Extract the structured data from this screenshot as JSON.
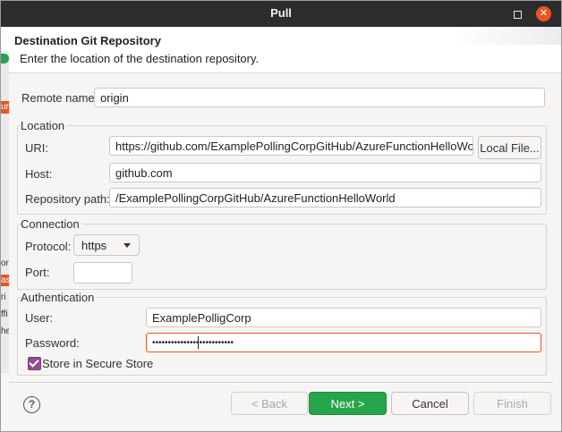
{
  "window": {
    "title": "Pull",
    "minimize_icon": "minimize-icon",
    "close_icon": "close-icon",
    "close_glyph": "✕"
  },
  "banner": {
    "title": "Destination Git Repository",
    "description": "Enter the location of the destination repository."
  },
  "side": {
    "marks": [
      "ur",
      "or",
      "as",
      "ri",
      "ffi",
      "he"
    ]
  },
  "remote": {
    "label": "Remote name:",
    "value": "origin"
  },
  "location": {
    "group_label": "Location",
    "uri_label": "URI:",
    "uri_value": "https://github.com/ExamplePollingCorpGitHub/AzureFunctionHelloWorld",
    "local_file_button": "Local File...",
    "host_label": "Host:",
    "host_value": "github.com",
    "path_label": "Repository path:",
    "path_value": "/ExamplePollingCorpGitHub/AzureFunctionHelloWorld"
  },
  "connection": {
    "group_label": "Connection",
    "protocol_label": "Protocol:",
    "protocol_value": "https",
    "port_label": "Port:",
    "port_value": ""
  },
  "authentication": {
    "group_label": "Authentication",
    "user_label": "User:",
    "user_value": "ExamplePolligCorp",
    "password_label": "Password:",
    "password_value": "••••••••••••••••••••••••••",
    "store_label": "Store in Secure Store",
    "store_checked": true
  },
  "footer": {
    "help_glyph": "?",
    "back_label": "< Back",
    "next_label": "Next >",
    "cancel_label": "Cancel",
    "finish_label": "Finish"
  },
  "colors": {
    "accent": "#e95420",
    "primary_button": "#26a44a",
    "checkbox": "#924d8b",
    "titlebar": "#2c2c2c"
  }
}
